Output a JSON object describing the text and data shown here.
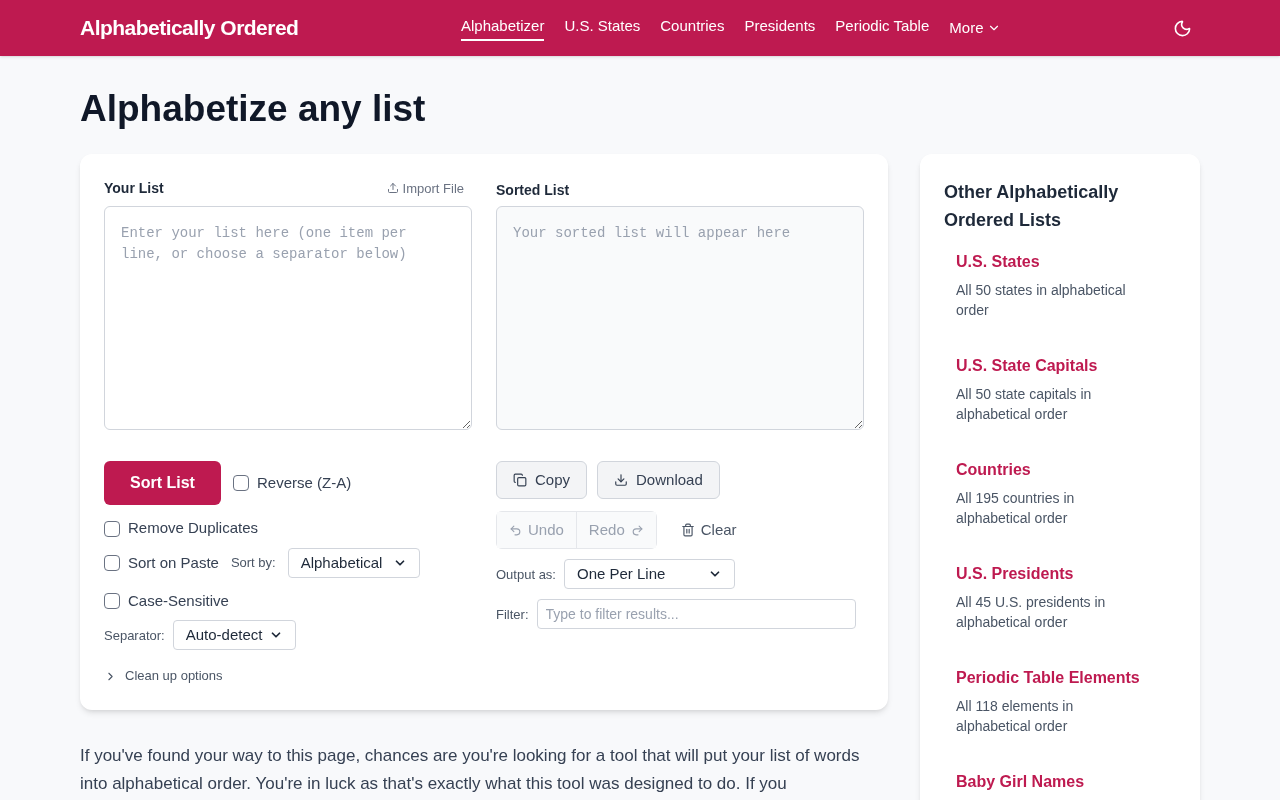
{
  "header": {
    "logo": "Alphabetically Ordered",
    "nav": [
      {
        "label": "Alphabetizer",
        "selected": true
      },
      {
        "label": "U.S. States",
        "selected": false
      },
      {
        "label": "Countries",
        "selected": false
      },
      {
        "label": "Presidents",
        "selected": false
      },
      {
        "label": "Periodic Table",
        "selected": false
      }
    ],
    "more": "More"
  },
  "title": "Alphabetize any list",
  "input": {
    "label": "Your List",
    "import": "Import File",
    "placeholder": "Enter your list here (one item per line, or choose a separator below)",
    "sort_button": "Sort List",
    "options": [
      {
        "label": "Reverse (Z-A)",
        "checked": false
      },
      {
        "label": "Remove Duplicates",
        "checked": false
      },
      {
        "label": "Sort on Paste",
        "checked": false
      },
      {
        "label": "Case-Sensitive",
        "checked": false
      }
    ],
    "sort_by": {
      "label": "Sort by:",
      "value": "Alphabetical"
    },
    "separator": {
      "label": "Separator:",
      "value": "Auto-detect"
    },
    "cleanup": "Clean up options"
  },
  "output": {
    "label": "Sorted List",
    "placeholder": "Your sorted list will appear here",
    "copy": "Copy",
    "download": "Download",
    "undo": {
      "label": "Undo",
      "disabled": true
    },
    "redo": {
      "label": "Redo",
      "disabled": true
    },
    "clear": "Clear",
    "output_as": {
      "label": "Output as:",
      "value": "One Per Line"
    },
    "filter": {
      "label": "Filter:",
      "placeholder": "Type to filter results..."
    }
  },
  "intro": "If you've found your way to this page, chances are you're looking for a tool that will put your list of words into alphabetical order. You're in luck as that's exactly what this tool was designed to do. If you",
  "sidebar": {
    "title": "Other Alphabetically Ordered Lists",
    "links": [
      {
        "title": "U.S. States",
        "desc": "All 50 states in alphabetical order"
      },
      {
        "title": "U.S. State Capitals",
        "desc": "All 50 state capitals in alphabetical order"
      },
      {
        "title": "Countries",
        "desc": "All 195 countries in alphabetical order"
      },
      {
        "title": "U.S. Presidents",
        "desc": "All 45 U.S. presidents in alphabetical order"
      },
      {
        "title": "Periodic Table Elements",
        "desc": "All 118 elements in alphabetical order"
      },
      {
        "title": "Baby Girl Names"
      }
    ]
  }
}
